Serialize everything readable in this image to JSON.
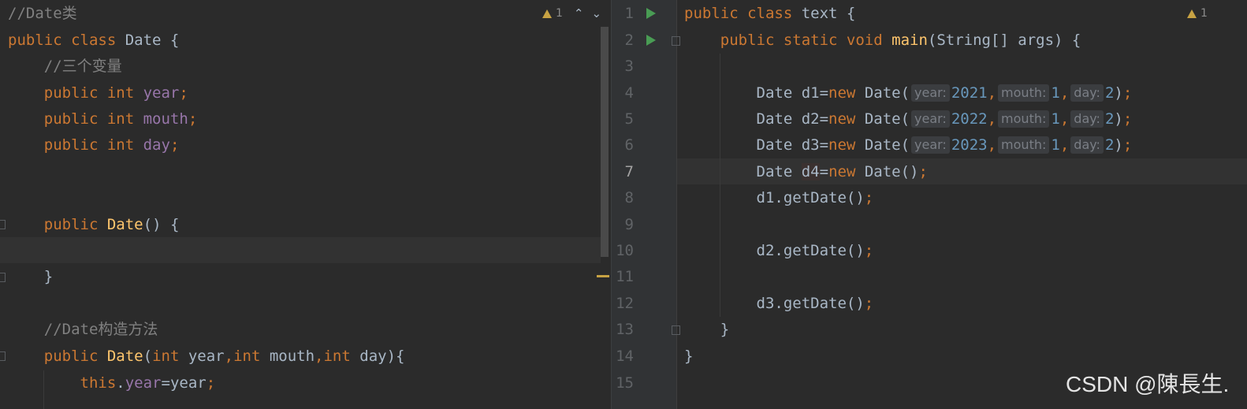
{
  "left_editor": {
    "warning_count": "1",
    "lines": {
      "l1_comment": "//Date类",
      "l2_kw": "public class",
      "l2_name": " Date {",
      "l3_comment": "//三个变量",
      "l4_kw": "public int",
      "l4_field": "year",
      "l5_kw": "public int",
      "l5_field": "mouth",
      "l6_kw": "public int",
      "l6_field": "day",
      "l9_kw": "public",
      "l9_fn": "Date",
      "l9_rest": "() {",
      "l11_brace": "}",
      "l13_comment": "//Date构造方法",
      "l14_kw": "public",
      "l14_fn": "Date",
      "l14_p1": "(",
      "l14_int1": "int",
      "l14_a1": " year",
      "l14_comma1": ",",
      "l14_int2": "int",
      "l14_a2": " mouth",
      "l14_comma2": ",",
      "l14_int3": "int",
      "l14_a3": " day",
      "l14_end": "){",
      "l15_this": "this",
      "l15_dot": ".",
      "l15_field": "year",
      "l15_rest": "=year",
      "semi": ";"
    }
  },
  "right_editor": {
    "warning_count": "1",
    "line_numbers": [
      "1",
      "2",
      "3",
      "4",
      "5",
      "6",
      "7",
      "8",
      "9",
      "10",
      "11",
      "12",
      "13",
      "14",
      "15"
    ],
    "active_line": "7",
    "code": {
      "r1_kw": "public class",
      "r1_rest": " text {",
      "r2_kw": "public static void",
      "r2_fn": "main",
      "r2_rest": "(String[] args) {",
      "date_kw": "Date ",
      "new_kw": "new",
      "ctor": " Date(",
      "hint_year": "year:",
      "hint_mouth": "mouth:",
      "hint_day": "day:",
      "d1": "d1=",
      "d2": "d2=",
      "d3": "d3=",
      "d4": "d4",
      "eq": "=",
      "y1": "2021",
      "y2": "2022",
      "y3": "2023",
      "m": "1",
      "d": "2",
      "comma": ",",
      "close": ");",
      "close_paren": ")",
      "empty_ctor": " Date()",
      "semi": ";",
      "call1": "d1.getDate()",
      "call2": "d2.getDate()",
      "call3": "d3.getDate()",
      "brace_close": "}"
    }
  },
  "watermark": "CSDN @陳長生."
}
